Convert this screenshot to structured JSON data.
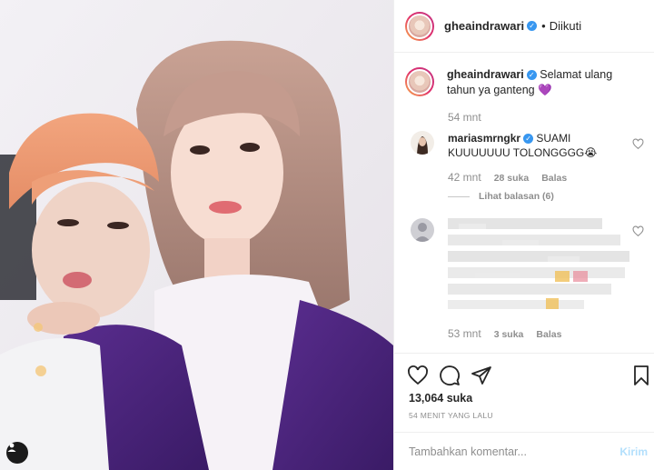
{
  "post": {
    "username": "gheaindrawari",
    "follow_status": "Diikuti",
    "dot": "•"
  },
  "caption": {
    "username": "gheaindrawari",
    "text": "Selamat ulang tahun ya ganteng",
    "emoji": "💜",
    "time": "54 mnt"
  },
  "comments": [
    {
      "username": "mariasmrngkr",
      "text": "SUAMI KUUUUUUU TOLONGGGG",
      "emoji": "😭",
      "time": "42 mnt",
      "likes": "28 suka",
      "reply_label": "Balas",
      "view_replies": "Lihat balasan (6)"
    },
    {
      "username": "",
      "text": "",
      "time": "53 mnt",
      "likes": "3 suka",
      "reply_label": "Balas"
    }
  ],
  "actions": {
    "likes": "13,064 suka",
    "timestamp": "54 MENIT YANG LALU"
  },
  "add_comment": {
    "placeholder": "Tambahkan komentar...",
    "post_label": "Kirim"
  },
  "icons": {
    "verified": "verified-badge-icon",
    "heart": "heart-icon",
    "comment": "comment-icon",
    "share": "share-icon",
    "save": "bookmark-icon",
    "user_tag": "user-tag-icon"
  },
  "colors": {
    "verified": "#3897f0",
    "post_button": "#b2dffc",
    "muted": "#8e8e8e",
    "caption_emoji": "#8a4fd8"
  }
}
